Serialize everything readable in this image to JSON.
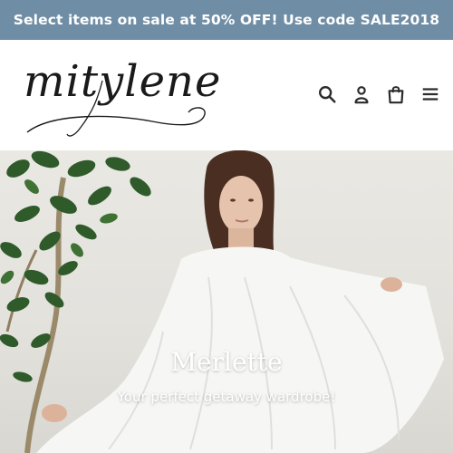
{
  "announcement": {
    "text": "Select items on sale at 50% OFF! Use code SALE2018",
    "background": "#6f8da5"
  },
  "header": {
    "logo_text": "mitylene",
    "icons": [
      "search-icon",
      "account-icon",
      "cart-icon",
      "menu-icon"
    ]
  },
  "hero": {
    "title": "Merlette",
    "subtitle": "Your perfect getaway wardrobe!"
  }
}
